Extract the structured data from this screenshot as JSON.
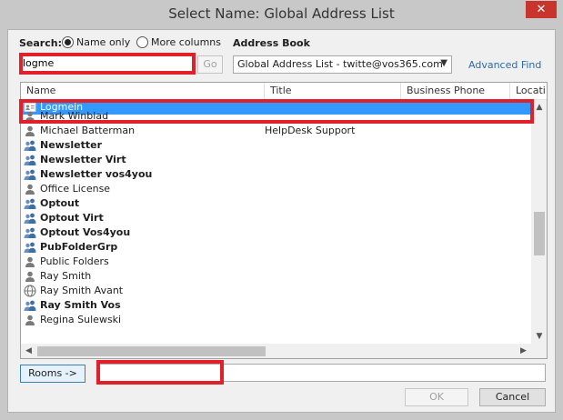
{
  "window": {
    "title": "Select Name: Global Address List",
    "close_glyph": "✕"
  },
  "search": {
    "label": "Search:",
    "mode_name_only": "Name only",
    "mode_more_columns": "More columns",
    "selected_mode": "Name only",
    "value": "logme",
    "go_label": "Go"
  },
  "address_book": {
    "label": "Address Book",
    "selected": "Global Address List - twitte@vos365.com",
    "advanced_find": "Advanced Find"
  },
  "columns": [
    "Name",
    "Title",
    "Business Phone",
    "Locati"
  ],
  "rows": [
    {
      "name": "Logmein",
      "title": "",
      "icon": "contact-card-icon",
      "bold": false,
      "selected": true
    },
    {
      "name": "Mark Winblad",
      "title": "",
      "icon": "user-icon",
      "bold": false,
      "selected": false
    },
    {
      "name": "Michael Batterman",
      "title": "HelpDesk Support",
      "icon": "user-icon",
      "bold": false,
      "selected": false
    },
    {
      "name": "Newsletter",
      "title": "",
      "icon": "group-icon",
      "bold": true,
      "selected": false
    },
    {
      "name": "Newsletter Virt",
      "title": "",
      "icon": "group-icon",
      "bold": true,
      "selected": false
    },
    {
      "name": "Newsletter vos4you",
      "title": "",
      "icon": "group-icon",
      "bold": true,
      "selected": false
    },
    {
      "name": "Office License",
      "title": "",
      "icon": "user-icon",
      "bold": false,
      "selected": false
    },
    {
      "name": "Optout",
      "title": "",
      "icon": "group-icon",
      "bold": true,
      "selected": false
    },
    {
      "name": "Optout Virt",
      "title": "",
      "icon": "group-icon",
      "bold": true,
      "selected": false
    },
    {
      "name": "Optout Vos4you",
      "title": "",
      "icon": "group-icon",
      "bold": true,
      "selected": false
    },
    {
      "name": "PubFolderGrp",
      "title": "",
      "icon": "group-icon",
      "bold": true,
      "selected": false
    },
    {
      "name": "Public Folders",
      "title": "",
      "icon": "user-icon",
      "bold": false,
      "selected": false
    },
    {
      "name": "Ray Smith",
      "title": "",
      "icon": "user-icon",
      "bold": false,
      "selected": false
    },
    {
      "name": "Ray Smith Avant",
      "title": "",
      "icon": "globe-user-icon",
      "bold": false,
      "selected": false
    },
    {
      "name": "Ray Smith Vos",
      "title": "",
      "icon": "group-icon",
      "bold": true,
      "selected": false
    },
    {
      "name": "Regina Sulewski",
      "title": "",
      "icon": "user-icon",
      "bold": false,
      "selected": false
    }
  ],
  "footer": {
    "rooms_label": "Rooms ->",
    "rooms_value": "",
    "ok_label": "OK",
    "cancel_label": "Cancel"
  },
  "colors": {
    "selection": "#3399ff",
    "highlight_box": "#e0202a",
    "link": "#2a6ab6",
    "close_button": "#c7352c",
    "user_icon": "#7a7a7a",
    "group_icon": "#3d6fa8"
  }
}
